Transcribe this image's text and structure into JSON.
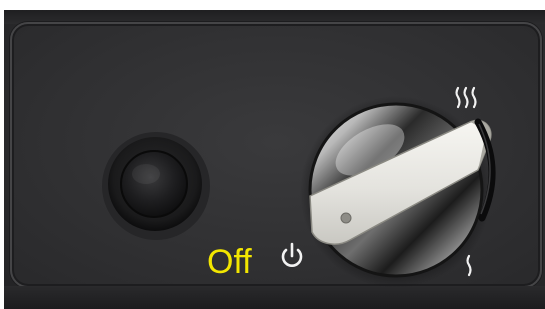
{
  "state_label": "Off",
  "colors": {
    "label": "#f2e600",
    "panel": "#333335",
    "knob_grip": "#ecebe6"
  },
  "icons": {
    "power": "power-icon",
    "heat_high": "heat-high-icon",
    "heat_low": "heat-low-icon"
  }
}
